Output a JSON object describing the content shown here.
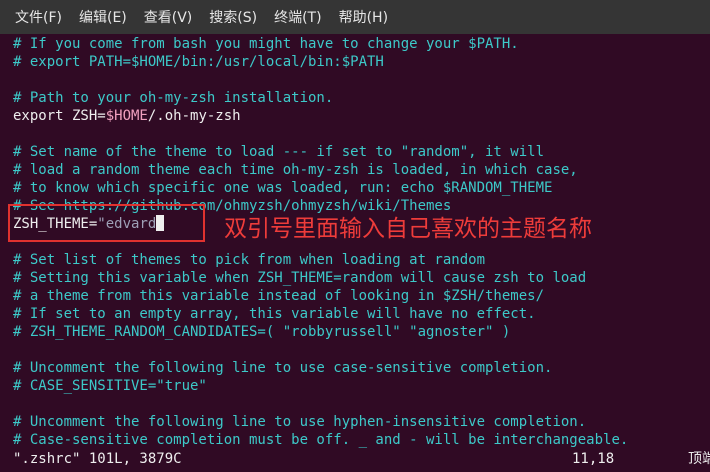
{
  "menu": {
    "items": [
      "文件(F)",
      "编辑(E)",
      "查看(V)",
      "搜索(S)",
      "终端(T)",
      "帮助(H)"
    ]
  },
  "lines": [
    "# If you come from bash you might have to change your $PATH.",
    "# export PATH=$HOME/bin:/usr/local/bin:$PATH",
    "",
    "# Path to your oh-my-zsh installation.",
    "",
    "",
    "# Set name of the theme to load --- if set to \"random\", it will",
    "# load a random theme each time oh-my-zsh is loaded, in which case,",
    "# to know which specific one was loaded, run: echo $RANDOM_THEME",
    "# See https://github.com/ohmyzsh/ohmyzsh/wiki/Themes",
    "",
    "",
    "# Set list of themes to pick from when loading at random",
    "# Setting this variable when ZSH_THEME=random will cause zsh to load",
    "# a theme from this variable instead of looking in $ZSH/themes/",
    "# If set to an empty array, this variable will have no effect.",
    "# ZSH_THEME_RANDOM_CANDIDATES=( \"robbyrussell\" \"agnoster\" )",
    "",
    "# Uncomment the following line to use case-sensitive completion.",
    "# CASE_SENSITIVE=\"true\"",
    "",
    "# Uncomment the following line to use hyphen-insensitive completion.",
    "# Case-sensitive completion must be off. _ and - will be interchangeable."
  ],
  "export_line": {
    "keyword": "export ZSH=",
    "var": "$HOME",
    "path": "/.oh-my-zsh"
  },
  "theme_line": {
    "key": "ZSH_THEME=",
    "value": "\"edvard"
  },
  "annotation": "双引号里面输入自己喜欢的主题名称",
  "status": {
    "file": "\".zshrc\" 101L, 3879C",
    "position": "11,18",
    "scroll": "顶端"
  },
  "colors": {
    "background": "#300a24",
    "comment": "#3dc9c9",
    "annotation": "#ee3c3a"
  }
}
